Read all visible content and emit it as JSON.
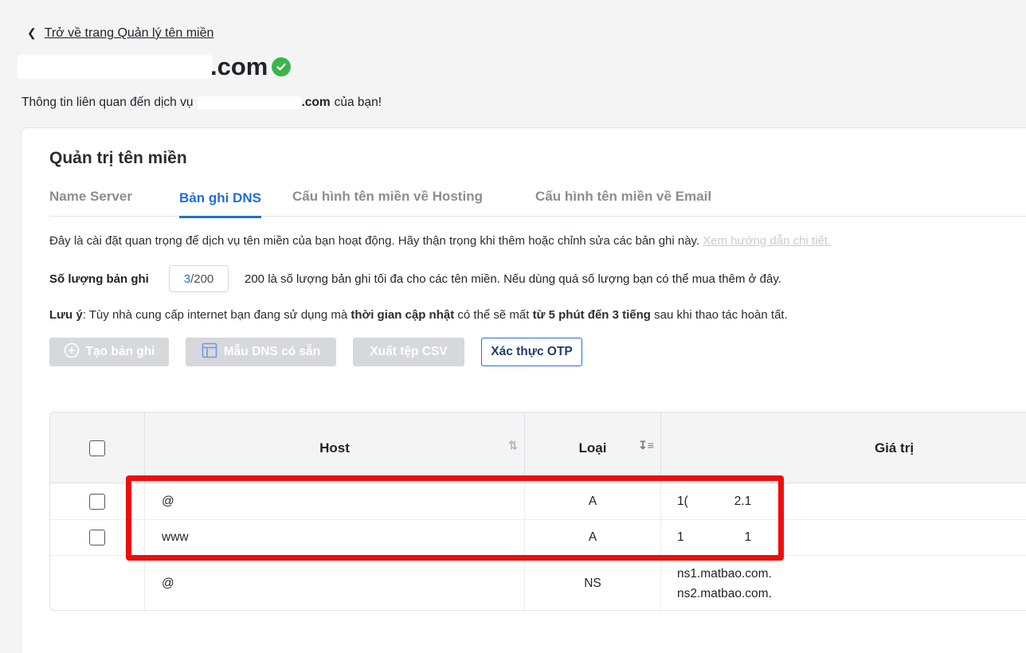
{
  "back_link": {
    "label": "Trở về trang Quản lý tên miền"
  },
  "domain": {
    "suffix": ".com",
    "verified": true
  },
  "subtitle": {
    "prefix": "Thông tin liên quan đến dịch vụ",
    "domain_suffix": ".com",
    "suffix": "của bạn!"
  },
  "card": {
    "title": "Quản trị tên miền"
  },
  "tabs": [
    {
      "label": "Name Server",
      "active": false
    },
    {
      "label": "Bản ghi DNS",
      "active": true
    },
    {
      "label": "Cấu hình tên miền về Hosting",
      "active": false
    },
    {
      "label": "Cấu hình tên miền về Email",
      "active": false
    }
  ],
  "notice": {
    "text": "Đây là cài đặt quan trọng để dịch vụ tên miền của bạn hoạt động. Hãy thận trọng khi thêm hoặc chỉnh sửa các bản ghi này.",
    "link": "Xem hướng dẫn chi tiết."
  },
  "record_count": {
    "label": "Số lượng bản ghi",
    "current": "3",
    "max": "/200",
    "info": "200 là số lượng bản ghi tối đa cho các tên miền. Nếu dùng quá số lượng bạn có thể mua thêm ở đây."
  },
  "note": {
    "label": "Lưu ý",
    "part1": ": Tùy nhà cung cấp internet bạn đang sử dụng mà",
    "bold1": "thời gian cập nhật",
    "part2": "có thể sẽ mất",
    "bold2": "từ 5 phút đến 3 tiếng",
    "part3": "sau khi thao tác hoàn tất."
  },
  "buttons": {
    "create": "Tạo bản ghi",
    "template": "Mẫu DNS có sẵn",
    "export": "Xuất tệp CSV",
    "otp": "Xác thực OTP"
  },
  "table": {
    "headers": {
      "host": "Host",
      "type": "Loại",
      "value": "Giá trị"
    },
    "rows": [
      {
        "host": "@",
        "type": "A",
        "value_start": "1(",
        "value_end": "2.1",
        "checkbox": true
      },
      {
        "host": "www",
        "type": "A",
        "value_start": "1",
        "value_end": "1",
        "checkbox": true
      },
      {
        "host": "@",
        "type": "NS",
        "value_line1": "ns1.matbao.com.",
        "value_line2": "ns2.matbao.com.",
        "checkbox": false
      }
    ]
  },
  "colors": {
    "accent": "#1f6fd6",
    "highlight": "#ee0d0d",
    "verified": "#3ab54a"
  }
}
